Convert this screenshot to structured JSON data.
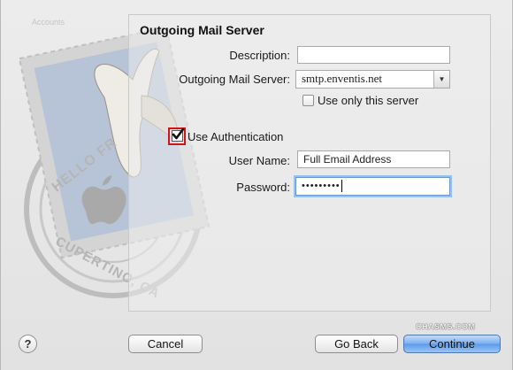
{
  "window": {
    "faint_label": "Accounts"
  },
  "panel": {
    "title": "Outgoing Mail Server"
  },
  "form": {
    "description_label": "Description:",
    "description_value": "",
    "server_label": "Outgoing Mail Server:",
    "server_value": "smtp.enventis.net",
    "use_only_label": "Use only this server",
    "use_only_checked": false,
    "auth_label": "Use Authentication",
    "auth_checked": true,
    "username_label": "User Name:",
    "username_value": "Full Email Address",
    "password_label": "Password:",
    "password_value": "•••••••••"
  },
  "stamp": {
    "top_text": "HELLO FR",
    "bottom_text": "CUPERTINO, CA"
  },
  "footer": {
    "help_label": "?",
    "cancel_label": "Cancel",
    "goback_label": "Go Back",
    "continue_label": "Continue"
  },
  "watermark": "CHASMS.COM",
  "colors": {
    "accent": "#5c9ae8",
    "highlight_border": "#d0141a",
    "focus_ring": "#9cc0ec"
  },
  "icons": {
    "stamp": "mail-stamp-icon",
    "help": "help-icon",
    "dropdown": "chevron-down-icon",
    "check": "checkmark-icon"
  }
}
